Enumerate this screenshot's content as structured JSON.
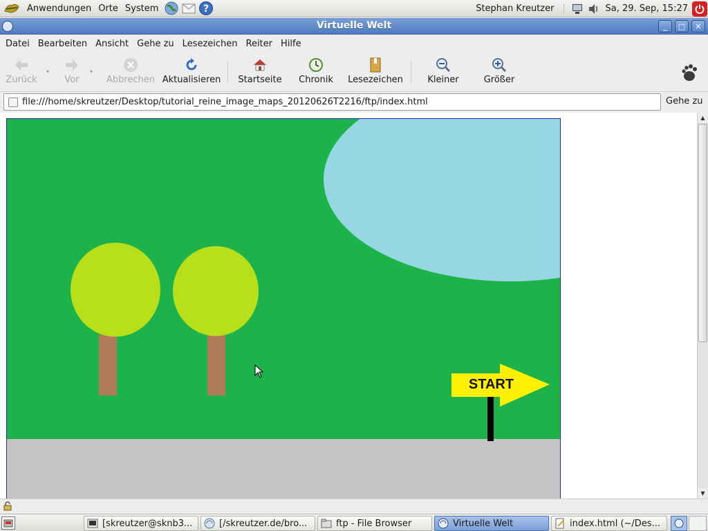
{
  "top_panel": {
    "menus": [
      "Anwendungen",
      "Orte",
      "System"
    ],
    "user": "Stephan Kreutzer",
    "clock": "Sa, 29. Sep, 15:27"
  },
  "window": {
    "title": "Virtuelle Welt"
  },
  "menubar": {
    "items": [
      "Datei",
      "Bearbeiten",
      "Ansicht",
      "Gehe zu",
      "Lesezeichen",
      "Reiter",
      "Hilfe"
    ]
  },
  "toolbar": {
    "back": "Zurück",
    "forward": "Vor",
    "stop": "Abbrechen",
    "reload": "Aktualisieren",
    "home": "Startseite",
    "history": "Chronik",
    "bookmarks": "Lesezeichen",
    "zoom_out": "Kleiner",
    "zoom_in": "Größer"
  },
  "location": {
    "url": "file:///home/skreutzer/Desktop/tutorial_reine_image_maps_20120626T2216/ftp/index.html",
    "go_label": "Gehe zu"
  },
  "page": {
    "sign_text": "START"
  },
  "colors": {
    "grass": "#1db34a",
    "lake": "#96d7e3",
    "tree_crown": "#b7e01b",
    "tree_trunk": "#b17a58",
    "ground": "#c4c4c4",
    "sign": "#ffef00",
    "titlebar": "#5f87c8"
  },
  "taskbar": {
    "items": [
      {
        "label": "[skreutzer@sknb3...",
        "icon": "terminal-icon"
      },
      {
        "label": "[/skreutzer.de/bro...",
        "icon": "browser-icon"
      },
      {
        "label": "ftp - File Browser",
        "icon": "folder-icon"
      },
      {
        "label": "Virtuelle Welt",
        "icon": "browser-icon"
      },
      {
        "label": "index.html (~/Des...",
        "icon": "text-editor-icon"
      }
    ]
  }
}
